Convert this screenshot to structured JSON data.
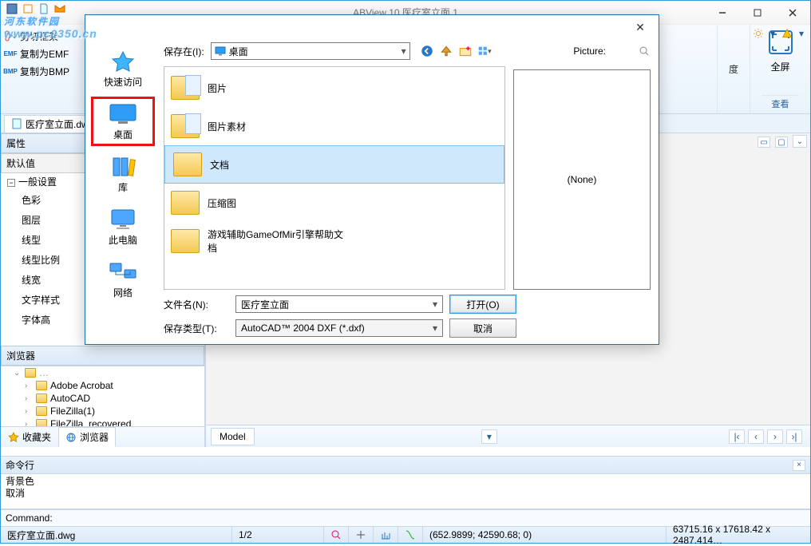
{
  "watermark": {
    "title": "河东软件园",
    "sub": "www.pc0350.cn"
  },
  "main_window": {
    "title": "ABView   10   医疗室立面 1"
  },
  "quick_access_tooltip": "",
  "ribbon": {
    "left_items": [
      {
        "icon": "scissors",
        "label": "剪切框架"
      },
      {
        "icon": "emf",
        "label": "复制为EMF"
      },
      {
        "icon": "bmp",
        "label": "复制为BMP"
      }
    ],
    "view_item": "查看",
    "fullscreen": {
      "label": "全屏",
      "group": "查看"
    },
    "tools": [
      "gear",
      "help",
      "dropdown"
    ],
    "extra_label": "度"
  },
  "file_tab": "医疗室立面.dw…",
  "properties": {
    "header": "属性",
    "default_row": "默认值",
    "group": "一般设置",
    "items": [
      "色彩",
      "图层",
      "线型",
      "线型比例",
      "线宽",
      "文字样式",
      "字体高"
    ]
  },
  "browser": {
    "header": "浏览器",
    "tree": [
      "Adobe Acrobat",
      "AutoCAD",
      "FileZilla(1)",
      "FileZilla_recovered"
    ]
  },
  "panel_tabs": {
    "fav": "收藏夹",
    "browser": "浏览器"
  },
  "model_tab": "Model",
  "command": {
    "header": "命令行",
    "history": [
      "背景色",
      "取消"
    ],
    "prompt": "Command:"
  },
  "status": {
    "file": "医疗室立面.dwg",
    "page": "1/2",
    "coords": "(652.9899; 42590.68; 0)",
    "right": "63715.16 x 17618.42 x 2487.414…"
  },
  "dialog": {
    "save_in_label": "保存在(I):",
    "location": "桌面",
    "places": [
      {
        "key": "quick",
        "label": "快速访问"
      },
      {
        "key": "desktop",
        "label": "桌面"
      },
      {
        "key": "library",
        "label": "库"
      },
      {
        "key": "pc",
        "label": "此电脑"
      },
      {
        "key": "network",
        "label": "网络"
      }
    ],
    "files": [
      {
        "label": "图片",
        "type": "folder-pic"
      },
      {
        "label": "图片素材",
        "type": "folder-pic"
      },
      {
        "label": "文档",
        "type": "folder-doc",
        "selected": true,
        "redbox": true
      },
      {
        "label": "压缩图",
        "type": "folder"
      },
      {
        "label": "游戏辅助GameOfMir引擎帮助文档",
        "type": "folder"
      }
    ],
    "preview_label": "Picture:",
    "preview_text": "(None)",
    "filename_label": "文件名(N):",
    "filename_value": "医疗室立面",
    "filetype_label": "保存类型(T):",
    "filetype_value": "AutoCAD™ 2004 DXF (*.dxf)",
    "open_btn": "打开(O)",
    "cancel_btn": "取消"
  }
}
